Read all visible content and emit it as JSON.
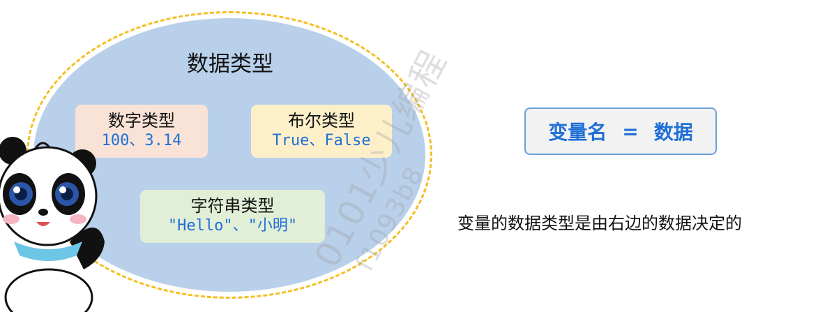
{
  "diagram": {
    "title": "数据类型",
    "types": [
      {
        "name": "数字类型",
        "example": "100、3.14"
      },
      {
        "name": "布尔类型",
        "example": "True、False"
      },
      {
        "name": "字符串类型",
        "example": "\"Hello\"、\"小明\""
      }
    ]
  },
  "equation": {
    "left": "变量名",
    "sign": "=",
    "right": "数据"
  },
  "note": "变量的数据类型是由右边的数据决定的",
  "watermark": {
    "line1": "0101少儿编程",
    "line2": "f1093b8"
  },
  "colors": {
    "ellipse": "#b9d0ea",
    "ring": "#f4bf22",
    "accent_blue": "#1f6fd6",
    "number_box": "#f9e3d6",
    "bool_box": "#fdf0c8",
    "string_box": "#e2efd7"
  },
  "icons": {
    "mascot": "panda-mascot-icon"
  }
}
